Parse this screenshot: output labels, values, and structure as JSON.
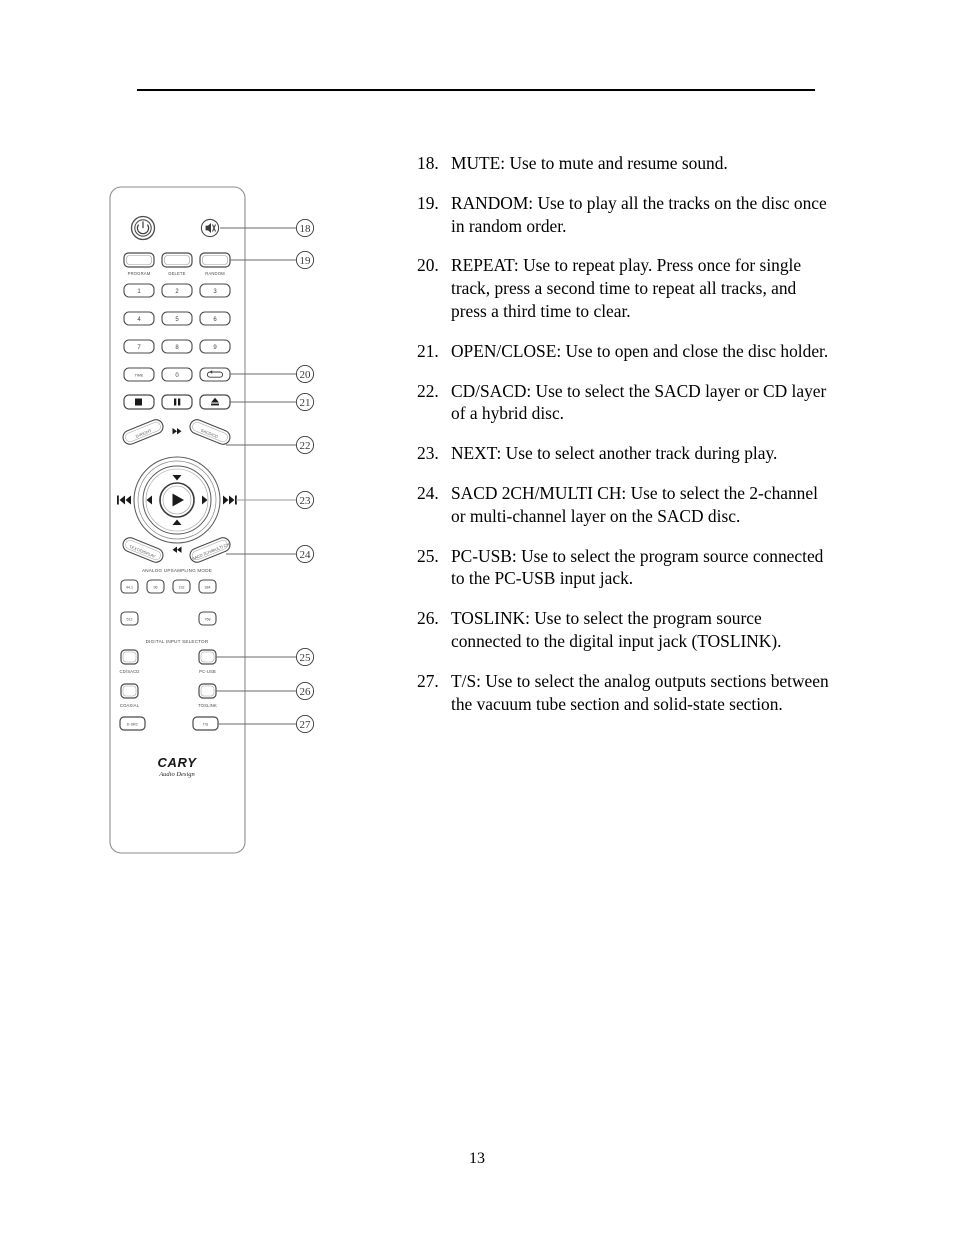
{
  "page": {
    "number": "13"
  },
  "instructions": [
    {
      "num": "18.",
      "text": "MUTE: Use to mute and resume sound."
    },
    {
      "num": "19.",
      "text": "RANDOM: Use to play all the tracks on the disc once in random order."
    },
    {
      "num": "20.",
      "text": "REPEAT: Use to repeat play. Press once for single track, press a second time to repeat all tracks, and press a third time to clear."
    },
    {
      "num": "21.",
      "text": "OPEN/CLOSE: Use to open and close the disc holder."
    },
    {
      "num": "22.",
      "text": "CD/SACD: Use to select the SACD layer or CD layer of a hybrid disc."
    },
    {
      "num": "23.",
      "text": "NEXT: Use to select another track during play."
    },
    {
      "num": "24.",
      "text": "SACD 2CH/MULTI CH: Use to select the 2-channel or multi-channel layer on the SACD disc."
    },
    {
      "num": "25.",
      "text": "PC-USB: Use to select the program source connected to the PC-USB input jack."
    },
    {
      "num": "26.",
      "text": "TOSLINK: Use to select the program source connected to the digital input jack (TOSLINK)."
    },
    {
      "num": "27.",
      "text": " T/S: Use to select the analog outputs sections between the vacuum tube section and solid-state section."
    }
  ],
  "remote": {
    "brand": "CARY",
    "brand_sub": "Audio Design",
    "top_row_labels": [
      "PROGRAM",
      "DELETE",
      "RANDOM"
    ],
    "keypad": [
      "1",
      "2",
      "3",
      "4",
      "5",
      "6",
      "7",
      "8",
      "9"
    ],
    "time_row": [
      "TIME",
      "0"
    ],
    "curved_buttons": {
      "top_left": "D-RIGHT",
      "top_right": "SACD/CD",
      "bottom_left": "TEXT/DISPLAY",
      "bottom_right": "SACD 2CH/MULTI CH"
    },
    "section_labels": {
      "upsampling": "ANALOG UPSAMPLING MODE",
      "digital_input": "DIGITAL INPUT SELECTOR"
    },
    "upsampling_rates": [
      "44.1",
      "96",
      "192",
      "384",
      "512",
      "768"
    ],
    "input_buttons": [
      {
        "label": "CD/SACD"
      },
      {
        "label": "PC-USB"
      },
      {
        "label": "COAXIAL"
      },
      {
        "label": "TOSLINK"
      },
      {
        "label": "D-SRC"
      },
      {
        "label": "T/S"
      }
    ],
    "callouts": [
      "18",
      "19",
      "20",
      "21",
      "22",
      "23",
      "24",
      "25",
      "26",
      "27"
    ]
  }
}
